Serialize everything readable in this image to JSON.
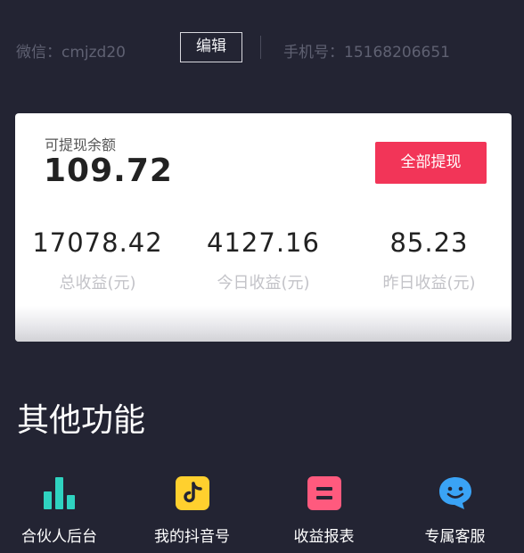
{
  "header": {
    "wechat": "微信：cmjzd20",
    "edit_label": "编辑",
    "phone": "手机号：15168206651"
  },
  "balance": {
    "label": "可提现余额",
    "value": "109.72",
    "withdraw_label": "全部提现"
  },
  "stats": [
    {
      "value": "17078.42",
      "label": "总收益(元)"
    },
    {
      "value": "4127.16",
      "label": "今日收益(元)"
    },
    {
      "value": "85.23",
      "label": "昨日收益(元)"
    }
  ],
  "section": {
    "title": "其他功能"
  },
  "functions": [
    {
      "label": "合伙人后台",
      "icon": "bar-chart-icon",
      "color": "#2fd3c0"
    },
    {
      "label": "我的抖音号",
      "icon": "tiktok-icon",
      "color": "#ffd02e"
    },
    {
      "label": "收益报表",
      "icon": "report-icon",
      "color": "#ff5a7e"
    },
    {
      "label": "专属客服",
      "icon": "customer-service-icon",
      "color": "#3aa3f5"
    }
  ]
}
